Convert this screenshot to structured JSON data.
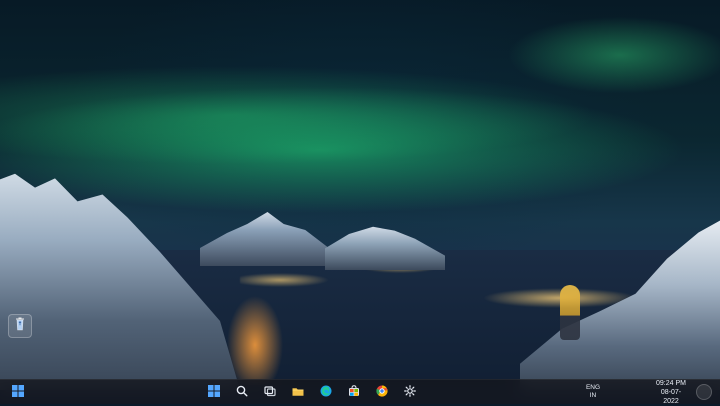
{
  "desktop": {
    "icons": [
      {
        "name": "recycle-bin",
        "icon": "recycle-bin-icon"
      }
    ]
  },
  "taskbar": {
    "start_icon": "windows-start-icon",
    "center_apps": [
      {
        "name": "start",
        "icon": "windows-start-icon"
      },
      {
        "name": "search",
        "icon": "search-icon"
      },
      {
        "name": "task-view",
        "icon": "task-view-icon"
      },
      {
        "name": "file-explorer",
        "icon": "folder-icon"
      },
      {
        "name": "edge",
        "icon": "edge-icon"
      },
      {
        "name": "store",
        "icon": "store-icon"
      },
      {
        "name": "chrome",
        "icon": "chrome-icon"
      },
      {
        "name": "settings",
        "icon": "gear-icon"
      }
    ],
    "tray": {
      "chevron_icon": "chevron-up-icon",
      "cloud_icon": "cloud-icon",
      "language": {
        "line1": "ENG",
        "line2": "IN"
      },
      "wifi_icon": "wifi-icon",
      "volume_icon": "volume-icon",
      "clock": {
        "time": "09:24 PM",
        "date": "08-07-2022"
      },
      "notification_icon": "notification-icon"
    }
  }
}
